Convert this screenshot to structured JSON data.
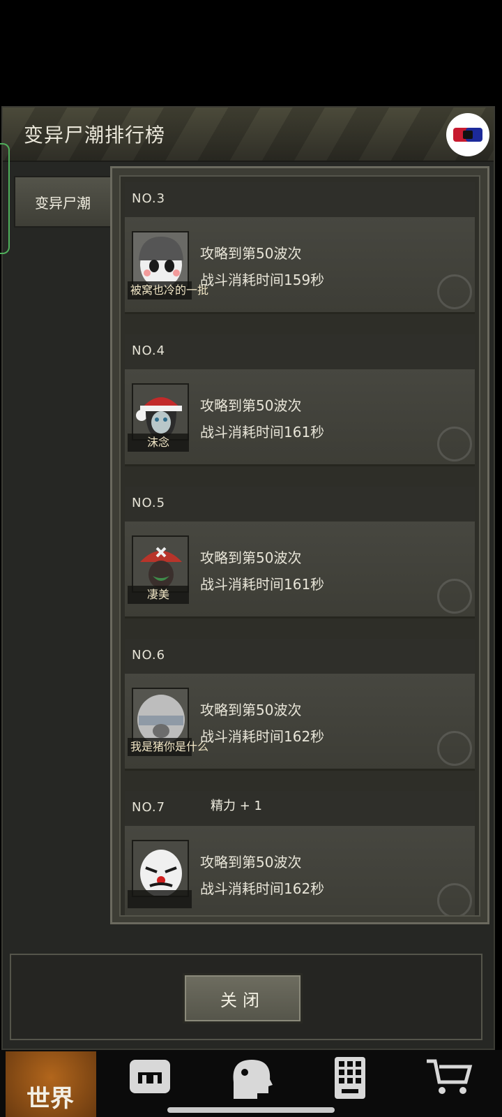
{
  "dialog": {
    "title": "变异尸潮排行榜",
    "side_tab": "变异尸潮",
    "close_label": "关闭"
  },
  "entries": [
    {
      "rank": "NO.3",
      "name": "被窝也冷的一批",
      "line1": "攻略到第50波次",
      "line2": "战斗消耗时间159秒"
    },
    {
      "rank": "NO.4",
      "name": "沫念",
      "line1": "攻略到第50波次",
      "line2": "战斗消耗时间161秒"
    },
    {
      "rank": "NO.5",
      "name": "凄美",
      "line1": "攻略到第50波次",
      "line2": "战斗消耗时间161秒"
    },
    {
      "rank": "NO.6",
      "name": "我是猪你是什么",
      "line1": "攻略到第50波次",
      "line2": "战斗消耗时间162秒"
    },
    {
      "rank": "NO.7",
      "name": "",
      "line1": "攻略到第50波次",
      "line2": "战斗消耗时间162秒"
    }
  ],
  "toast": "精力 + 1",
  "bottom_nav": {
    "world_label": "世界",
    "icons": [
      "backpack-icon",
      "head-icon",
      "phone-icon",
      "cart-icon"
    ]
  }
}
